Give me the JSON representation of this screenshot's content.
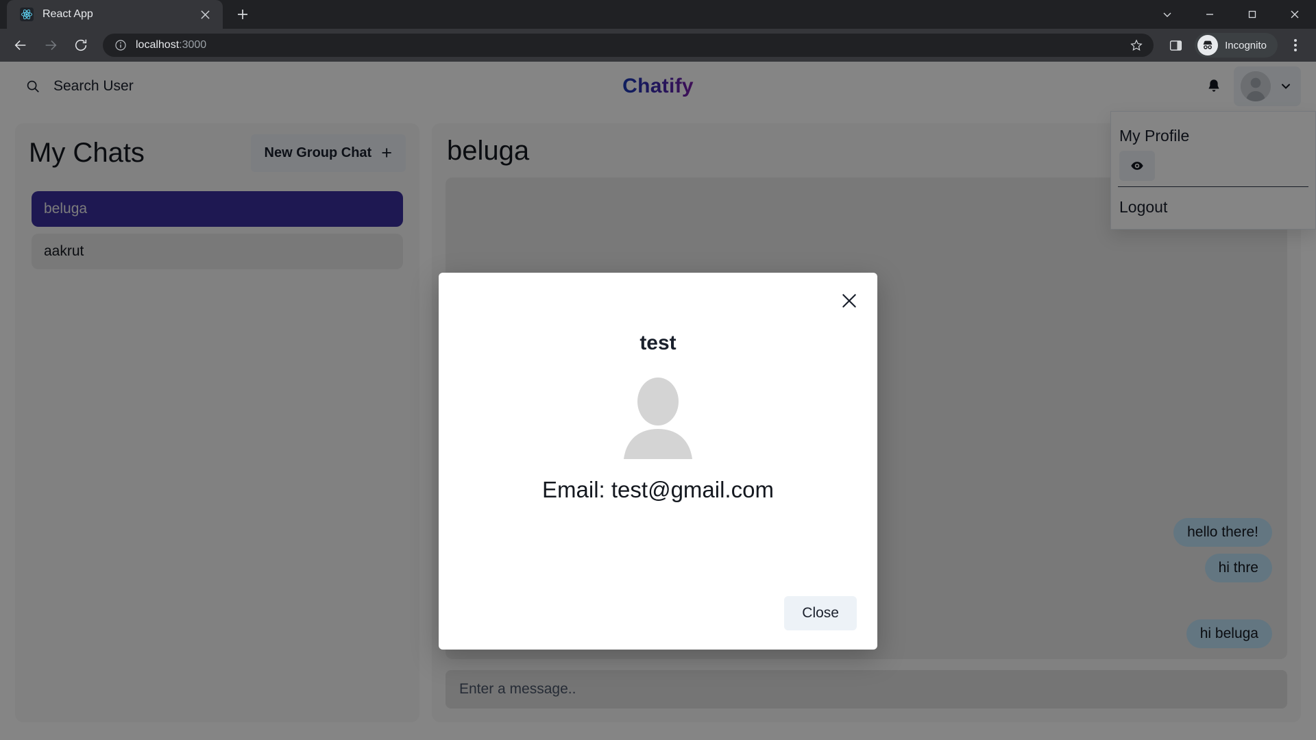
{
  "browser": {
    "tab": {
      "title": "React App",
      "favicon_icon": "react-logo-icon",
      "close_icon": "close-icon"
    },
    "new_tab_icon": "plus-icon",
    "window_controls": {
      "collapse_icon": "chevron-down-icon",
      "minimize_icon": "minimize-icon",
      "maximize_icon": "maximize-icon",
      "close_icon": "close-icon"
    },
    "toolbar": {
      "back_icon": "arrow-left-icon",
      "forward_icon": "arrow-right-icon",
      "reload_icon": "reload-icon",
      "site_info_icon": "info-circle-icon",
      "url_host": "localhost",
      "url_port": ":3000",
      "bookmark_icon": "star-icon",
      "side_panel_icon": "side-panel-icon",
      "incognito_label": "Incognito",
      "incognito_icon": "incognito-icon",
      "menu_icon": "kebab-menu-icon"
    }
  },
  "app": {
    "brand": "Chatify",
    "brand_gradient_from": "#1B3BB5",
    "brand_gradient_to": "#7A1FA8",
    "search": {
      "label": "Search User",
      "icon": "search-icon"
    },
    "header_right": {
      "notifications_icon": "bell-icon",
      "avatar_icon": "user-avatar-icon",
      "chevron_icon": "chevron-down-icon"
    },
    "profile_menu": {
      "heading": "My Profile",
      "view_icon": "eye-icon",
      "logout": "Logout"
    },
    "chats": {
      "title": "My Chats",
      "new_group_label": "New Group Chat",
      "new_group_icon": "plus-icon",
      "items": [
        {
          "name": "beluga",
          "active": true
        },
        {
          "name": "aakrut",
          "active": false
        }
      ],
      "active_color": "#3B2E9E"
    },
    "conversation": {
      "title": "beluga",
      "messages": [
        {
          "text": "hello there!",
          "side": "right",
          "spaced": false
        },
        {
          "text": "hi thre",
          "side": "right",
          "spaced": false
        },
        {
          "text": "hi beluga",
          "side": "right",
          "spaced": true
        }
      ],
      "bubble_color": "#BEE3F8",
      "input_placeholder": "Enter a message.."
    },
    "modal": {
      "name": "test",
      "avatar_icon": "user-avatar-icon",
      "email": "Email: test@gmail.com",
      "close_label": "Close",
      "close_icon": "close-icon"
    }
  }
}
